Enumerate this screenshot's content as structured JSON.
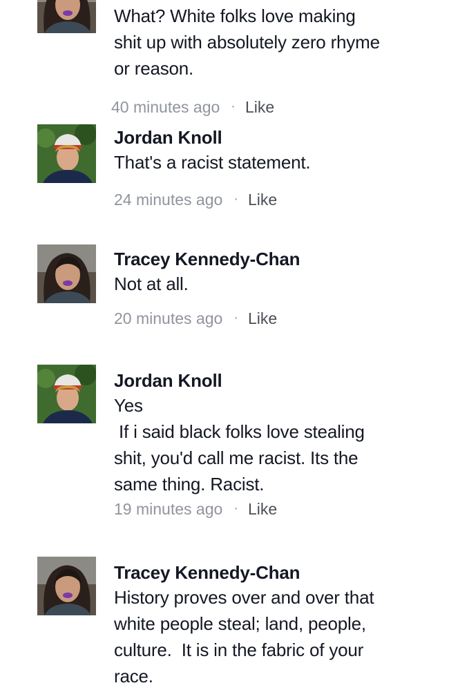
{
  "comments": [
    {
      "author": "",
      "avatar": "tracey-avatar",
      "text_lines": [
        "What?  White folks love making",
        "shit up with absolutely zero rhyme",
        "or reason."
      ],
      "time": "40 minutes ago",
      "like_label": "Like",
      "separator": "·"
    },
    {
      "author": "Jordan Knoll",
      "avatar": "jordan-avatar",
      "text_lines": [
        "That's a racist statement."
      ],
      "time": "24 minutes ago",
      "like_label": "Like",
      "separator": "·"
    },
    {
      "author": "Tracey Kennedy-Chan",
      "avatar": "tracey-avatar",
      "text_lines": [
        "Not at all."
      ],
      "time": "20 minutes ago",
      "like_label": "Like",
      "separator": "·"
    },
    {
      "author": "Jordan Knoll",
      "avatar": "jordan-avatar",
      "text_lines": [
        "Yes",
        " If i said black folks love stealing",
        "shit, you'd call me racist. Its the",
        "same thing. Racist."
      ],
      "time": "19 minutes ago",
      "like_label": "Like",
      "separator": "·"
    },
    {
      "author": "Tracey Kennedy-Chan",
      "avatar": "tracey-avatar",
      "text_lines": [
        "History proves over and over that",
        "white people steal; land, people,",
        "culture.  It is in the fabric of your",
        "race."
      ],
      "time": "",
      "like_label": "",
      "separator": ""
    }
  ]
}
